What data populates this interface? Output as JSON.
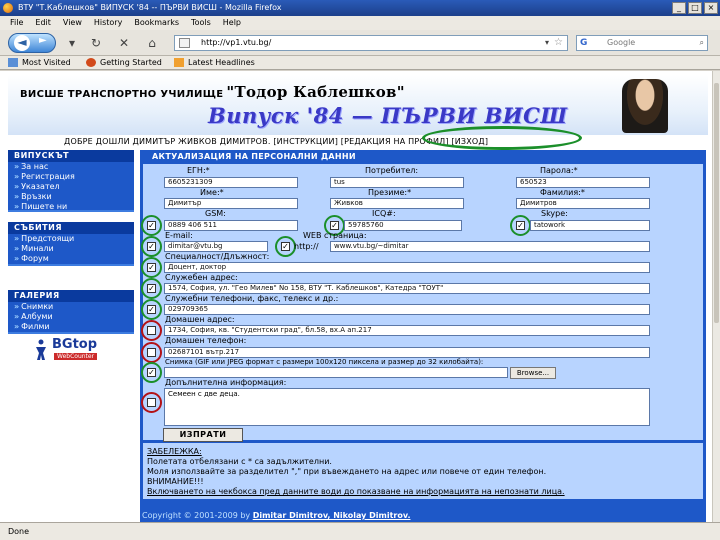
{
  "window": {
    "title": "ВТУ \"Т.Каблешков\" ВИПУСК '84 -- ПЪРВИ ВИСШ - Mozilla Firefox",
    "controls": [
      "_",
      "□",
      "×"
    ]
  },
  "menu": [
    "File",
    "Edit",
    "View",
    "History",
    "Bookmarks",
    "Tools",
    "Help"
  ],
  "nav": {
    "url": "http://vp1.vtu.bg/",
    "search_placeholder": "Google",
    "search_engine": "G"
  },
  "bookmarks": [
    "Most Visited",
    "Getting Started",
    "Latest Headlines"
  ],
  "status": "Done",
  "banner": {
    "school": "ВИСШЕ ТРАНСПОРТНО УЧИЛИЩЕ",
    "school_name": "\"Тодор Каблешков\"",
    "subtitle": "Випуск '84 — ПЪРВИ ВИСШ"
  },
  "welcome": {
    "greeting": "ДОБРЕ ДОШЛИ ДИМИТЪР ЖИВКОВ ДИМИТРОВ.",
    "link_instructions": "[ИНСТРУКЦИИ]",
    "link_edit_profile": "[РЕДАКЦИЯ НА ПРОФИЛ]",
    "link_logout": "[ИЗХОД]"
  },
  "sidebar": {
    "sections": [
      {
        "title": "ВИПУСКЪТ",
        "items": [
          "За нас",
          "Регистрация",
          "Указател",
          "Връзки",
          "Пишете ни"
        ]
      },
      {
        "title": "СЪБИТИЯ",
        "items": [
          "Предстоящи",
          "Минали",
          "Форум"
        ]
      },
      {
        "title": "ГАЛЕРИЯ",
        "items": [
          "Снимки",
          "Албуми",
          "Филми"
        ]
      }
    ],
    "badge": {
      "title": "BGtop",
      "subtitle": "WebCounter"
    }
  },
  "form": {
    "title": "АКТУАЛИЗАЦИЯ НА ПЕРСОНАЛНИ ДАННИ",
    "egn_label": "ЕГН:*",
    "egn_value": "6605231309",
    "nick_label": "Потребител:",
    "nick_value": "tus",
    "pass_label": "Парола:*",
    "pass_value": "650523",
    "name_label": "Име:*",
    "name_value": "Димитър",
    "middle_label": "Презиме:*",
    "middle_value": "Живков",
    "last_label": "Фамилия:*",
    "last_value": "Димитров",
    "gsm_label": "GSM:",
    "gsm_value": "0889 406 511",
    "icq_label": "ICQ#:",
    "icq_value": "59785760",
    "skype_label": "Skype:",
    "skype_value": "tatowork",
    "email_label": "E-mail:",
    "email_value": "dimitar@vtu.bg",
    "web_label": "WEB страница:",
    "web_prefix": "http://",
    "web_value": "www.vtu.bg/~dimitar",
    "occupation_label": "Специалност/Длъжност:",
    "occupation_value": "Доцент, доктор",
    "work_addr_label": "Служебен адрес:",
    "work_addr_value": "1574, София, ул. \"Гео Милев\" No 158, ВТУ \"Т. Каблешков\", Катедра \"ТОУТ\"",
    "work_phone_label": "Служебни телефони, факс, телекс и др.:",
    "work_phone_value": "029709365",
    "home_addr_label": "Домашен адрес:",
    "home_addr_value": "1734, София, кв. \"Студентски град\", бл.58, вх.А ап.217",
    "home_phone_label": "Домашен телефон:",
    "home_phone_value": "02687101 вътр.217",
    "photo_label": "Снимка (GIF или JPEG формат с размери 100х120 пиксела и размер до 32 килобайта):",
    "browse_label": "Browse...",
    "extra_label": "Допълнителна информация:",
    "extra_value": "Семеен с две деца.",
    "submit_label": "ИЗПРАТИ",
    "visibility_marks": [
      "✓",
      "✓",
      "✓",
      "✓",
      "✓",
      "✓",
      "✓",
      "✓",
      "✓",
      "",
      "",
      "✓",
      ""
    ]
  },
  "notes": {
    "title": "ЗАБЕЛЕЖКА:",
    "line1": "Полетата отбелязани с * са задължителни.",
    "line2": "Моля използвайте за разделител \",\" при въвеждането на адрес или повече от един телефон.",
    "attention": "ВНИМАНИЕ!!!",
    "line3": "Включването на чекбокса пред данните води до показване на информацията на непознати лица."
  },
  "copyright": {
    "text": "Copyright © 2001-2009 by",
    "authors": "Dimitar Dimitrov, Nikolay Dimitrov."
  }
}
